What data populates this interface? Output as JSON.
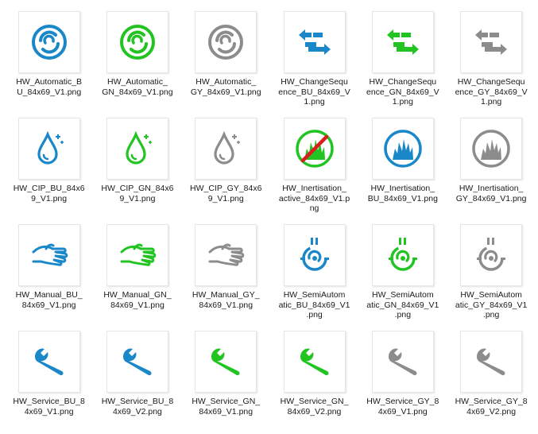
{
  "colors": {
    "BU": "#1a87c9",
    "GN": "#22c422",
    "GY": "#8c8c8c",
    "RD": "#d81e1e"
  },
  "files": [
    {
      "name": "HW_Automatic_BU_84x69_V1.png",
      "lines": [
        "HW_Automatic_B",
        "U_84x69_V1.png"
      ],
      "icon": "automatic-icon",
      "color": "BU"
    },
    {
      "name": "HW_Automatic_GN_84x69_V1.png",
      "lines": [
        "HW_Automatic_",
        "GN_84x69_V1.png"
      ],
      "icon": "automatic-icon",
      "color": "GN"
    },
    {
      "name": "HW_Automatic_GY_84x69_V1.png",
      "lines": [
        "HW_Automatic_",
        "GY_84x69_V1.png"
      ],
      "icon": "automatic-icon",
      "color": "GY"
    },
    {
      "name": "HW_ChangeSequence_BU_84x69_V1.png",
      "lines": [
        "HW_ChangeSequ",
        "ence_BU_84x69_V",
        "1.png"
      ],
      "icon": "change-sequence-icon",
      "color": "BU"
    },
    {
      "name": "HW_ChangeSequence_GN_84x69_V1.png",
      "lines": [
        "HW_ChangeSequ",
        "ence_GN_84x69_V",
        "1.png"
      ],
      "icon": "change-sequence-icon",
      "color": "GN"
    },
    {
      "name": "HW_ChangeSequence_GY_84x69_V1.png",
      "lines": [
        "HW_ChangeSequ",
        "ence_GY_84x69_V",
        "1.png"
      ],
      "icon": "change-sequence-icon",
      "color": "GY"
    },
    {
      "name": "HW_CIP_BU_84x69_V1.png",
      "lines": [
        "HW_CIP_BU_84x6",
        "9_V1.png"
      ],
      "icon": "cip-drop-icon",
      "color": "BU"
    },
    {
      "name": "HW_CIP_GN_84x69_V1.png",
      "lines": [
        "HW_CIP_GN_84x6",
        "9_V1.png"
      ],
      "icon": "cip-drop-icon",
      "color": "GN"
    },
    {
      "name": "HW_CIP_GY_84x69_V1.png",
      "lines": [
        "HW_CIP_GY_84x6",
        "9_V1.png"
      ],
      "icon": "cip-drop-icon",
      "color": "GY"
    },
    {
      "name": "HW_Inertisation_active_84x69_V1.png",
      "lines": [
        "HW_Inertisation_",
        "active_84x69_V1.p",
        "ng"
      ],
      "icon": "inertisation-active-icon",
      "color": "GN"
    },
    {
      "name": "HW_Inertisation_BU_84x69_V1.png",
      "lines": [
        "HW_Inertisation_",
        "BU_84x69_V1.png"
      ],
      "icon": "inertisation-icon",
      "color": "BU"
    },
    {
      "name": "HW_Inertisation_GY_84x69_V1.png",
      "lines": [
        "HW_Inertisation_",
        "GY_84x69_V1.png"
      ],
      "icon": "inertisation-icon",
      "color": "GY"
    },
    {
      "name": "HW_Manual_BU_84x69_V1.png",
      "lines": [
        "HW_Manual_BU_",
        "84x69_V1.png"
      ],
      "icon": "manual-hand-icon",
      "color": "BU"
    },
    {
      "name": "HW_Manual_GN_84x69_V1.png",
      "lines": [
        "HW_Manual_GN_",
        "84x69_V1.png"
      ],
      "icon": "manual-hand-icon",
      "color": "GN"
    },
    {
      "name": "HW_Manual_GY_84x69_V1.png",
      "lines": [
        "HW_Manual_GY_",
        "84x69_V1.png"
      ],
      "icon": "manual-hand-icon",
      "color": "GY"
    },
    {
      "name": "HW_SemiAutomatic_BU_84x69_V1.png",
      "lines": [
        "HW_SemiAutom",
        "atic_BU_84x69_V1",
        ".png"
      ],
      "icon": "semi-automatic-icon",
      "color": "BU"
    },
    {
      "name": "HW_SemiAutomatic_GN_84x69_V1.png",
      "lines": [
        "HW_SemiAutom",
        "atic_GN_84x69_V1",
        ".png"
      ],
      "icon": "semi-automatic-icon",
      "color": "GN"
    },
    {
      "name": "HW_SemiAutomatic_GY_84x69_V1.png",
      "lines": [
        "HW_SemiAutom",
        "atic_GY_84x69_V1",
        ".png"
      ],
      "icon": "semi-automatic-icon",
      "color": "GY"
    },
    {
      "name": "HW_Service_BU_84x69_V1.png",
      "lines": [
        "HW_Service_BU_8",
        "4x69_V1.png"
      ],
      "icon": "service-wrench-icon",
      "color": "BU"
    },
    {
      "name": "HW_Service_BU_84x69_V2.png",
      "lines": [
        "HW_Service_BU_8",
        "4x69_V2.png"
      ],
      "icon": "service-wrench-icon",
      "color": "BU"
    },
    {
      "name": "HW_Service_GN_84x69_V1.png",
      "lines": [
        "HW_Service_GN_",
        "84x69_V1.png"
      ],
      "icon": "service-wrench-icon",
      "color": "GN"
    },
    {
      "name": "HW_Service_GN_84x69_V2.png",
      "lines": [
        "HW_Service_GN_",
        "84x69_V2.png"
      ],
      "icon": "service-wrench-icon",
      "color": "GN"
    },
    {
      "name": "HW_Service_GY_84x69_V1.png",
      "lines": [
        "HW_Service_GY_8",
        "4x69_V1.png"
      ],
      "icon": "service-wrench-icon",
      "color": "GY"
    },
    {
      "name": "HW_Service_GY_84x69_V2.png",
      "lines": [
        "HW_Service_GY_8",
        "4x69_V2.png"
      ],
      "icon": "service-wrench-icon",
      "color": "GY"
    }
  ]
}
